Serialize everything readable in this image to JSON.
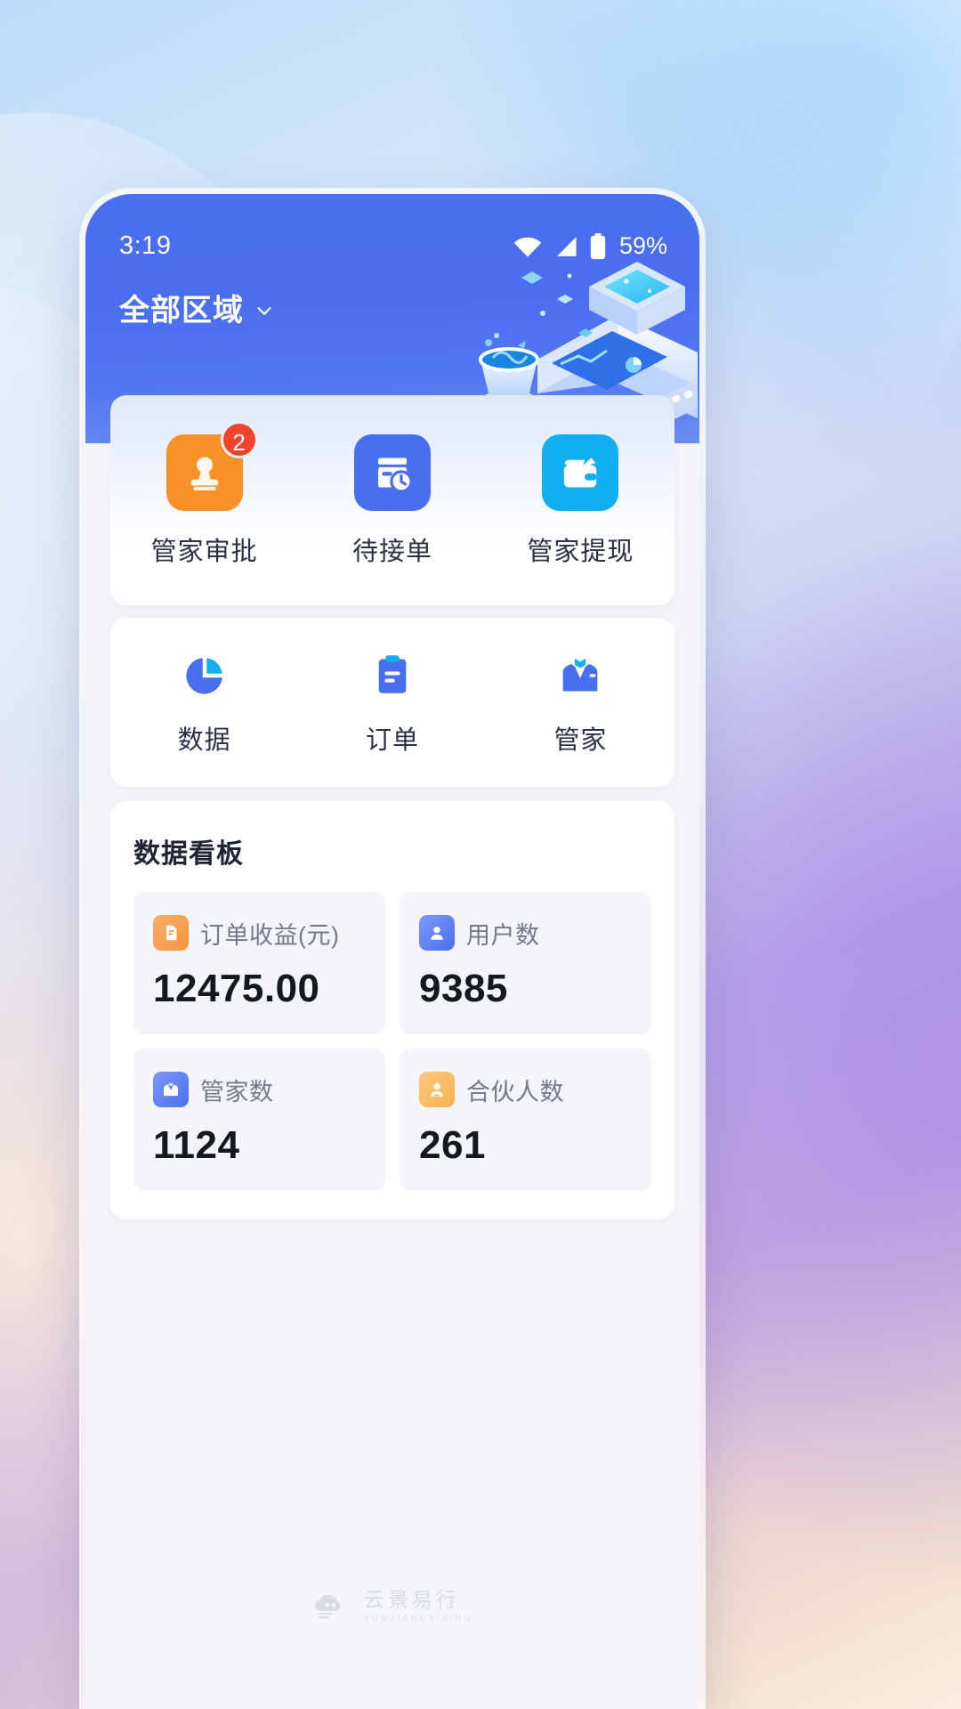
{
  "status_bar": {
    "time": "3:19",
    "battery_percent": "59%",
    "icons": [
      "wifi-icon",
      "signal-icon",
      "battery-icon"
    ]
  },
  "header": {
    "region_label": "全部区域",
    "chevron": "chevron-down-icon",
    "illustration": "data-analytics-3d-illustration",
    "background_color": "#4a6ef0"
  },
  "quick_actions": [
    {
      "label": "管家审批",
      "icon": "stamp-approval-icon",
      "color": "#f89227",
      "badge": "2"
    },
    {
      "label": "待接单",
      "icon": "pending-order-icon",
      "color": "#4a6ef0",
      "badge": ""
    },
    {
      "label": "管家提现",
      "icon": "wallet-withdraw-icon",
      "color": "#11aef0",
      "badge": ""
    }
  ],
  "mini_actions": [
    {
      "label": "数据",
      "icon": "pie-chart-icon"
    },
    {
      "label": "订单",
      "icon": "clipboard-icon"
    },
    {
      "label": "管家",
      "icon": "butler-suit-icon"
    }
  ],
  "dashboard": {
    "title": "数据看板",
    "stats": [
      {
        "name": "订单收益(元)",
        "value": "12475.00",
        "icon": "receipt-icon",
        "color": "#f59b4a"
      },
      {
        "name": "用户数",
        "value": "9385",
        "icon": "user-icon",
        "color": "#5b7cf5"
      },
      {
        "name": "管家数",
        "value": "1124",
        "icon": "butler-suit-icon",
        "color": "#5b7cf5"
      },
      {
        "name": "合伙人数",
        "value": "261",
        "icon": "partner-user-icon",
        "color": "#f6b köz"
      }
    ]
  },
  "watermark": {
    "logo": "cloud-cat-logo-icon",
    "name_cn": "云景易行",
    "name_en": "YUNXIANGYIXING"
  }
}
